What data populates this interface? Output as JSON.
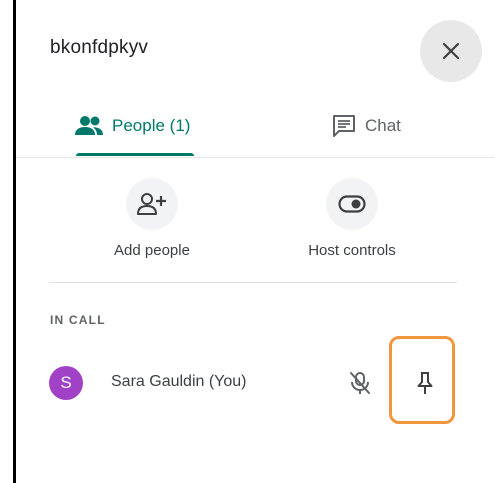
{
  "header": {
    "title": "bkonfdpkyv",
    "close_icon": "close-icon"
  },
  "tabs": [
    {
      "label": "People (1)",
      "icon": "people-icon",
      "active": true
    },
    {
      "label": "Chat",
      "icon": "chat-icon",
      "active": false
    }
  ],
  "actions": [
    {
      "label": "Add people",
      "icon": "add-person-icon"
    },
    {
      "label": "Host controls",
      "icon": "toggle-icon"
    }
  ],
  "in_call": {
    "section_label": "IN CALL",
    "participants": [
      {
        "initial": "S",
        "name": "Sara Gauldin (You)",
        "avatar_color": "#a142c6",
        "muted": true
      }
    ]
  },
  "colors": {
    "accent": "#00796b",
    "highlight": "#f0963e",
    "avatar": "#a142c6"
  }
}
